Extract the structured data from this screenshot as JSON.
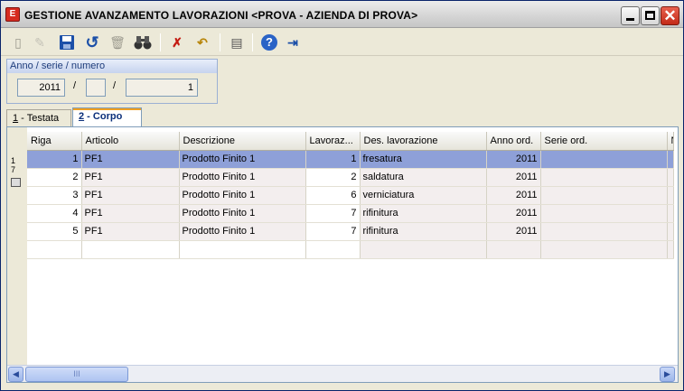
{
  "window": {
    "title": "GESTIONE AVANZAMENTO LAVORAZIONI <PROVA - AZIENDA DI PROVA>",
    "app_icon": "app-logo-icon",
    "close_glyph": "✕"
  },
  "toolbar": {
    "buttons": [
      {
        "icon": "new-document-icon",
        "glyph": "▯",
        "enabled": false
      },
      {
        "icon": "edit-icon",
        "glyph": "✎",
        "enabled": false
      },
      {
        "icon": "save-icon",
        "glyph": "💾",
        "enabled": true
      },
      {
        "icon": "undo-icon",
        "glyph": "↺",
        "enabled": true
      },
      {
        "icon": "delete-icon",
        "glyph": "🗑",
        "enabled": false
      },
      {
        "icon": "search-icon",
        "glyph": "🔭",
        "enabled": true
      },
      {
        "icon": "delete-rows-icon",
        "glyph": "✗",
        "enabled": true
      },
      {
        "icon": "restore-icon",
        "glyph": "↶",
        "enabled": true
      },
      {
        "icon": "print-icon",
        "glyph": "▤",
        "enabled": true
      },
      {
        "icon": "help-icon",
        "glyph": "?",
        "enabled": true
      },
      {
        "icon": "exit-icon",
        "glyph": "⇥",
        "enabled": true
      }
    ]
  },
  "header": {
    "group_label": "Anno / serie / numero",
    "anno": "2011",
    "serie": "",
    "numero": "1",
    "separator": "/"
  },
  "tabs": [
    {
      "key": "1",
      "label": " - Testata",
      "active": false
    },
    {
      "key": "2",
      "label": " - Corpo",
      "active": true
    }
  ],
  "rowbar": {
    "line1": "1",
    "line2": "7"
  },
  "grid": {
    "columns": [
      "Riga",
      "Articolo",
      "Descrizione",
      "Lavoraz...",
      "Des. lavorazione",
      "Anno ord.",
      "Serie ord.",
      "N"
    ],
    "rows": [
      {
        "riga": "1",
        "articolo": "PF1",
        "descrizione": "Prodotto Finito 1",
        "lavorazione": "1",
        "des_lavorazione": "fresatura",
        "anno_ord": "2011",
        "serie_ord": "",
        "selected": true
      },
      {
        "riga": "2",
        "articolo": "PF1",
        "descrizione": "Prodotto Finito 1",
        "lavorazione": "2",
        "des_lavorazione": "saldatura",
        "anno_ord": "2011",
        "serie_ord": "",
        "selected": false
      },
      {
        "riga": "3",
        "articolo": "PF1",
        "descrizione": "Prodotto Finito 1",
        "lavorazione": "6",
        "des_lavorazione": "verniciatura",
        "anno_ord": "2011",
        "serie_ord": "",
        "selected": false
      },
      {
        "riga": "4",
        "articolo": "PF1",
        "descrizione": "Prodotto Finito 1",
        "lavorazione": "7",
        "des_lavorazione": "rifinitura",
        "anno_ord": "2011",
        "serie_ord": "",
        "selected": false
      },
      {
        "riga": "5",
        "articolo": "PF1",
        "descrizione": "Prodotto Finito 1",
        "lavorazione": "7",
        "des_lavorazione": "rifinitura",
        "anno_ord": "2011",
        "serie_ord": "",
        "selected": false
      }
    ]
  },
  "scrollbar": {
    "left_glyph": "◀",
    "right_glyph": "▶",
    "thumb_grip": "III"
  }
}
